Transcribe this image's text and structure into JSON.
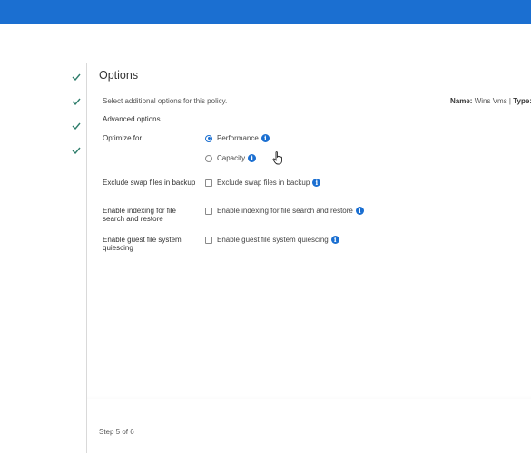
{
  "page": {
    "title": "Options",
    "description": "Select additional options for this policy.",
    "meta": {
      "name_label": "Name:",
      "name_value": "Wins Vms",
      "type_label": "Type:",
      "type_value": "V"
    },
    "section_title": "Advanced options"
  },
  "steps": {
    "completed": 4,
    "icon": "check-icon"
  },
  "options": {
    "optimize_label": "Optimize for",
    "performance_label": "Performance",
    "capacity_label": "Capacity",
    "selected": "Performance",
    "swap_label": "Exclude swap files in backup",
    "swap_option": "Exclude swap files in backup",
    "indexing_label": "Enable indexing for file search and restore",
    "indexing_option": "Enable indexing for file search and restore",
    "quiescing_label": "Enable guest file system quiescing",
    "quiescing_option": "Enable guest file system quiescing"
  },
  "footer": {
    "step_text": "Step 5 of 6"
  },
  "colors": {
    "accent": "#1b6fd1",
    "check": "#2e7d6b"
  }
}
